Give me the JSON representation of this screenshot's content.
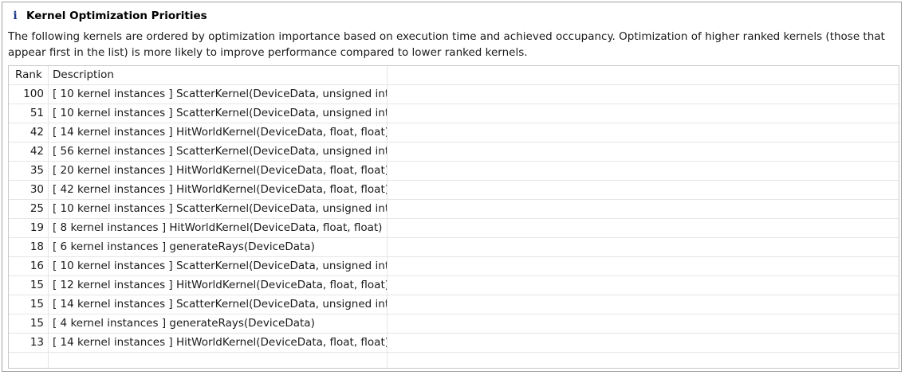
{
  "panel": {
    "icon": "info-icon",
    "title": "Kernel Optimization Priorities",
    "description": "The following kernels are ordered by optimization importance based on execution time and achieved occupancy. Optimization of higher ranked kernels (those that appear first in the list) is more likely to improve performance compared to lower ranked kernels."
  },
  "table": {
    "columns": [
      "Rank",
      "Description"
    ],
    "rows": [
      {
        "rank": "100",
        "description": "[ 10 kernel instances ] ScatterKernel(DeviceData, unsigned int)"
      },
      {
        "rank": "51",
        "description": "[ 10 kernel instances ] ScatterKernel(DeviceData, unsigned int)"
      },
      {
        "rank": "42",
        "description": "[ 14 kernel instances ] HitWorldKernel(DeviceData, float, float)"
      },
      {
        "rank": "42",
        "description": "[ 56 kernel instances ] ScatterKernel(DeviceData, unsigned int)"
      },
      {
        "rank": "35",
        "description": "[ 20 kernel instances ] HitWorldKernel(DeviceData, float, float)"
      },
      {
        "rank": "30",
        "description": "[ 42 kernel instances ] HitWorldKernel(DeviceData, float, float)"
      },
      {
        "rank": "25",
        "description": "[ 10 kernel instances ] ScatterKernel(DeviceData, unsigned int)"
      },
      {
        "rank": "19",
        "description": "[ 8 kernel instances ] HitWorldKernel(DeviceData, float, float)"
      },
      {
        "rank": "18",
        "description": "[ 6 kernel instances ] generateRays(DeviceData)"
      },
      {
        "rank": "16",
        "description": "[ 10 kernel instances ] ScatterKernel(DeviceData, unsigned int)"
      },
      {
        "rank": "15",
        "description": "[ 12 kernel instances ] HitWorldKernel(DeviceData, float, float)"
      },
      {
        "rank": "15",
        "description": "[ 14 kernel instances ] ScatterKernel(DeviceData, unsigned int)"
      },
      {
        "rank": "15",
        "description": "[ 4 kernel instances ] generateRays(DeviceData)"
      },
      {
        "rank": "13",
        "description": "[ 14 kernel instances ] HitWorldKernel(DeviceData, float, float)"
      }
    ]
  }
}
